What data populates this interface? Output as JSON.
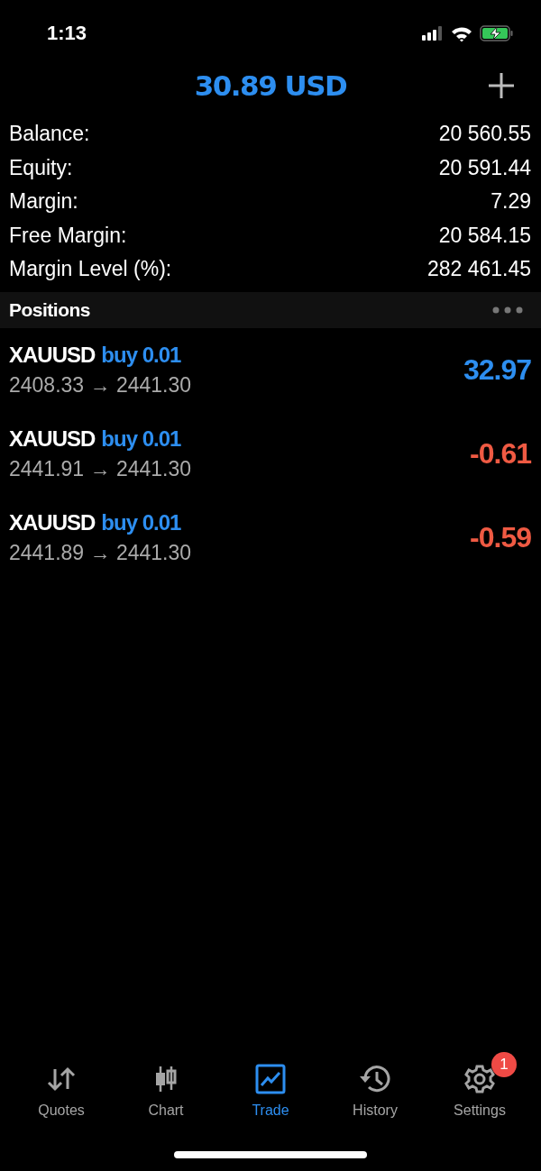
{
  "status_bar": {
    "time": "1:13"
  },
  "header": {
    "title": "30.89 USD"
  },
  "summary": [
    {
      "label": "Balance:",
      "value": "20 560.55"
    },
    {
      "label": "Equity:",
      "value": "20 591.44"
    },
    {
      "label": "Margin:",
      "value": "7.29"
    },
    {
      "label": "Free Margin:",
      "value": "20 584.15"
    },
    {
      "label": "Margin Level (%):",
      "value": "282 461.45"
    }
  ],
  "positions_header": {
    "title": "Positions"
  },
  "positions": [
    {
      "symbol": "XAUUSD",
      "side": "buy 0.01",
      "prices": "2408.33 → 2441.30",
      "profit": "32.97",
      "kind": "gain"
    },
    {
      "symbol": "XAUUSD",
      "side": "buy 0.01",
      "prices": "2441.91 → 2441.30",
      "profit": "-0.61",
      "kind": "loss"
    },
    {
      "symbol": "XAUUSD",
      "side": "buy 0.01",
      "prices": "2441.89 → 2441.30",
      "profit": "-0.59",
      "kind": "loss"
    }
  ],
  "tabs": [
    {
      "label": "Quotes",
      "kind": "quotes",
      "selected": false
    },
    {
      "label": "Chart",
      "kind": "chart",
      "selected": false
    },
    {
      "label": "Trade",
      "kind": "trade",
      "selected": true
    },
    {
      "label": "History",
      "kind": "history",
      "selected": false
    },
    {
      "label": "Settings",
      "kind": "settings",
      "selected": false,
      "badge": "1"
    }
  ]
}
